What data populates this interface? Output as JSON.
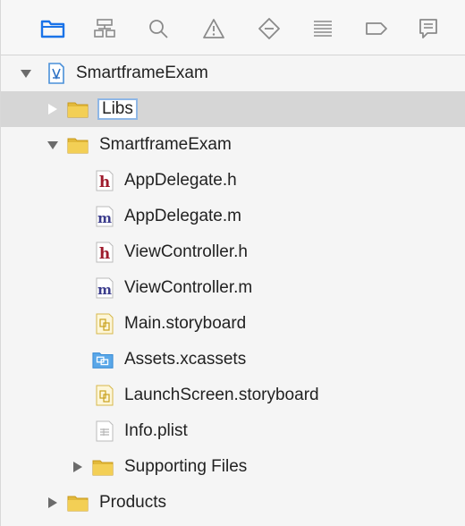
{
  "toolbar": {
    "items": [
      {
        "name": "project-navigator",
        "icon": "folder-icon",
        "active": true
      },
      {
        "name": "symbol-navigator",
        "icon": "hierarchy-icon"
      },
      {
        "name": "find-navigator",
        "icon": "search-icon"
      },
      {
        "name": "issue-navigator",
        "icon": "warning-icon"
      },
      {
        "name": "test-navigator",
        "icon": "diamond-minus-icon"
      },
      {
        "name": "debug-navigator",
        "icon": "list-icon"
      },
      {
        "name": "breakpoint-navigator",
        "icon": "tag-icon"
      },
      {
        "name": "report-navigator",
        "icon": "message-icon"
      }
    ],
    "active_color": "#1a73e8",
    "icon_color": "#8a8a8a"
  },
  "tree": {
    "project": "SmartframeExam",
    "libs": "Libs",
    "group": "SmartframeExam",
    "files": {
      "app_delegate_h": "AppDelegate.h",
      "app_delegate_m": "AppDelegate.m",
      "view_controller_h": "ViewController.h",
      "view_controller_m": "ViewController.m",
      "main_storyboard": "Main.storyboard",
      "assets": "Assets.xcassets",
      "launch_storyboard": "LaunchScreen.storyboard",
      "info_plist": "Info.plist"
    },
    "supporting_files": "Supporting Files",
    "products": "Products",
    "file_badges": {
      "header": "h",
      "implementation": "m"
    }
  }
}
